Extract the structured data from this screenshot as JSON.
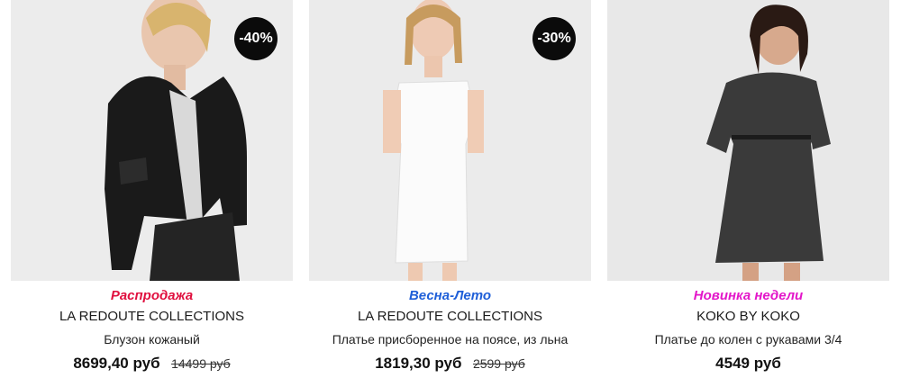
{
  "colors": {
    "sale": "#e0103f",
    "spring": "#1f5fd8",
    "new": "#e316c9",
    "badge": "#0b0b0b"
  },
  "products": [
    {
      "tag": "Распродажа",
      "brand": "LA REDOUTE COLLECTIONS",
      "name": "Блузон кожаный",
      "price": "8699,40 руб",
      "old_price": "14499 руб",
      "badge": "-40%"
    },
    {
      "tag": "Весна-Лето",
      "brand": "LA REDOUTE COLLECTIONS",
      "name": "Платье присборенное на поясе, из льна",
      "price": "1819,30 руб",
      "old_price": "2599 руб",
      "badge": "-30%"
    },
    {
      "tag": "Новинка недели",
      "brand": "KOKO BY KOKO",
      "name": "Платье до колен с рукавами 3/4",
      "price": "4549 руб"
    }
  ]
}
